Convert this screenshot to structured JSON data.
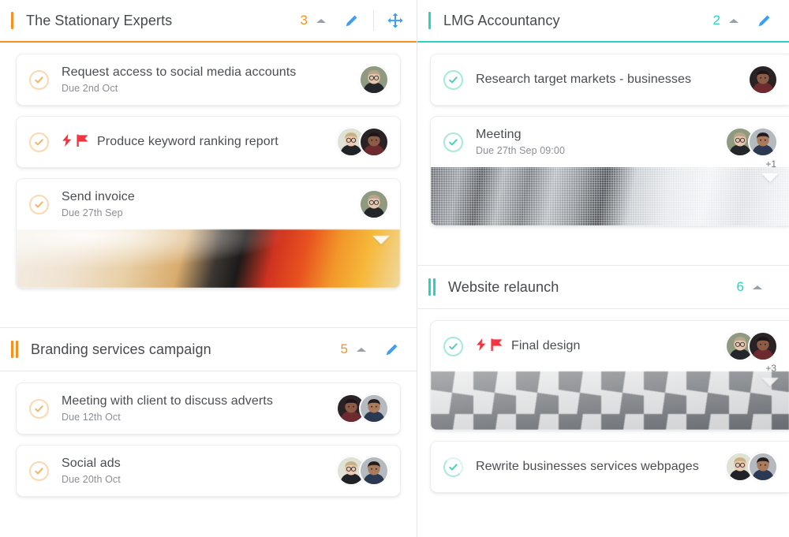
{
  "colors": {
    "accent_orange": "#f6901e",
    "accent_teal": "#2ad2c0",
    "edit_blue": "#3c9ff2",
    "flag_red": "#f5333f",
    "title_text": "#4a4d52",
    "due_text": "#8a8f96"
  },
  "columns": [
    {
      "id": "left",
      "sections": [
        {
          "id": "the-stationary-experts",
          "kind": "main",
          "accent": "orange",
          "title": "The Stationary Experts",
          "count": "3",
          "collapse_icon": "chevron-up-icon",
          "edit_icon": "pencil-icon",
          "move_icon": "move-arrows-icon",
          "has_move": true,
          "tasks": [
            {
              "title": "Request access to social media accounts",
              "due": "Due 2nd Oct",
              "check": "check-circle-orange",
              "flags": [],
              "avatars": [
                "avatar-woman-glasses"
              ],
              "plus": null,
              "attachment": null
            },
            {
              "title": "Produce keyword ranking report",
              "due": null,
              "check": "check-circle-orange",
              "flags": [
                "lightning-icon",
                "flag-icon"
              ],
              "avatars": [
                "avatar-woman-blonde",
                "avatar-woman-dark"
              ],
              "plus": null,
              "attachment": null
            },
            {
              "title": "Send invoice",
              "due": "Due 27th Sep",
              "check": "check-circle-orange",
              "flags": [],
              "avatars": [
                "avatar-woman-glasses"
              ],
              "plus": null,
              "attachment": "pencils"
            }
          ]
        },
        {
          "id": "branding-services-campaign",
          "kind": "sub",
          "accent": "orange",
          "title": "Branding services campaign",
          "count": "5",
          "collapse_icon": "chevron-up-icon",
          "edit_icon": "pencil-icon",
          "move_icon": null,
          "has_move": false,
          "tasks": [
            {
              "title": "Meeting with client to discuss adverts",
              "due": "Due 12th Oct",
              "check": "check-circle-orange",
              "flags": [],
              "avatars": [
                "avatar-woman-dark",
                "avatar-man-beard"
              ],
              "plus": null,
              "attachment": null
            },
            {
              "title": "Social ads",
              "due": "Due 20th Oct",
              "check": "check-circle-orange",
              "flags": [],
              "avatars": [
                "avatar-woman-blonde",
                "avatar-man-beard"
              ],
              "plus": null,
              "attachment": null
            }
          ]
        }
      ]
    },
    {
      "id": "right",
      "sections": [
        {
          "id": "lmg-accountancy",
          "kind": "main",
          "accent": "teal",
          "title": "LMG Accountancy",
          "count": "2",
          "collapse_icon": "chevron-up-icon",
          "edit_icon": "pencil-icon",
          "move_icon": null,
          "has_move": false,
          "tasks": [
            {
              "title": "Research target markets - businesses",
              "due": null,
              "check": "check-circle-teal",
              "flags": [],
              "avatars": [
                "avatar-woman-dark"
              ],
              "plus": null,
              "attachment": null
            },
            {
              "title": "Meeting",
              "due": "Due 27th Sep 09:00",
              "check": "check-circle-teal",
              "flags": [],
              "avatars": [
                "avatar-woman-glasses",
                "avatar-man-beard"
              ],
              "plus": "+1",
              "attachment": "meeting"
            }
          ]
        },
        {
          "id": "website-relaunch",
          "kind": "sub",
          "accent": "teal",
          "title": "Website relaunch",
          "count": "6",
          "collapse_icon": "chevron-up-icon",
          "edit_icon": null,
          "move_icon": null,
          "has_move": false,
          "tasks": [
            {
              "title": "Final design",
              "due": null,
              "check": "check-circle-teal",
              "flags": [
                "lightning-icon",
                "flag-icon"
              ],
              "avatars": [
                "avatar-woman-glasses",
                "avatar-woman-dark"
              ],
              "plus": "+3",
              "attachment": "checkered"
            },
            {
              "title": "Rewrite businesses services webpages",
              "due": null,
              "check": "check-circle-teal-partial",
              "flags": [],
              "avatars": [
                "avatar-woman-blonde",
                "avatar-man-beard"
              ],
              "plus": null,
              "attachment": null
            }
          ]
        }
      ]
    }
  ]
}
